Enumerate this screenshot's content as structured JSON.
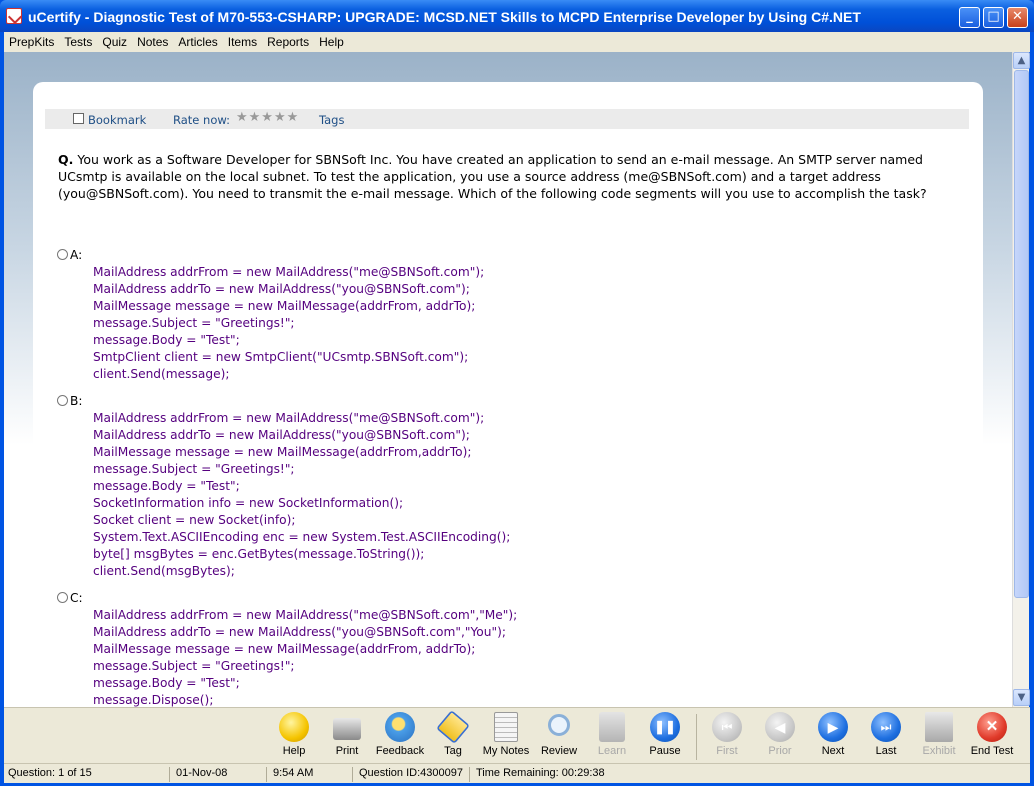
{
  "window": {
    "title": "uCertify - Diagnostic Test of  M70-553-CSHARP: UPGRADE: MCSD.NET Skills to MCPD Enterprise Developer by Using C#.NET",
    "minimize": "_",
    "maximize": "□",
    "close": "✕"
  },
  "menu": [
    "PrepKits",
    "Tests",
    "Quiz",
    "Notes",
    "Articles",
    "Items",
    "Reports",
    "Help"
  ],
  "question_toolbar": {
    "bookmark": "Bookmark",
    "rate_now": "Rate now:",
    "stars": "★★★★★",
    "tags": "Tags"
  },
  "question": {
    "prefix": "Q.",
    "text": "You work as a Software Developer for SBNSoft Inc. You have created an application to send an e-mail message. An SMTP server named UCsmtp is available on the local subnet. To test the application, you use a source address (me@SBNSoft.com) and a target address (you@SBNSoft.com). You need to transmit the e-mail message. Which of the following code segments will you use to accomplish the task?"
  },
  "options": [
    {
      "label": "A:",
      "lines": [
        "MailAddress addrFrom = new MailAddress(\"me@SBNSoft.com\");",
        "MailAddress addrTo = new MailAddress(\"you@SBNSoft.com\");",
        "MailMessage message = new MailMessage(addrFrom, addrTo);",
        "message.Subject = \"Greetings!\";",
        "message.Body = \"Test\";",
        "SmtpClient client = new SmtpClient(\"UCsmtp.SBNSoft.com\");",
        "client.Send(message);"
      ]
    },
    {
      "label": "B:",
      "lines": [
        "MailAddress addrFrom = new MailAddress(\"me@SBNSoft.com\");",
        "MailAddress addrTo = new MailAddress(\"you@SBNSoft.com\");",
        "MailMessage message = new MailMessage(addrFrom,addrTo);",
        "message.Subject = \"Greetings!\";",
        "message.Body = \"Test\";",
        "SocketInformation info = new SocketInformation();",
        "Socket client = new Socket(info);",
        "System.Text.ASCIIEncoding enc = new System.Test.ASCIIEncoding();",
        "byte[] msgBytes = enc.GetBytes(message.ToString());",
        "client.Send(msgBytes);"
      ]
    },
    {
      "label": "C:",
      "lines": [
        "MailAddress addrFrom = new MailAddress(\"me@SBNSoft.com\",\"Me\");",
        "MailAddress addrTo = new MailAddress(\"you@SBNSoft.com\",\"You\");",
        "MailMessage message = new MailMessage(addrFrom, addrTo);",
        "message.Subject = \"Greetings!\";",
        "message.Body = \"Test\";",
        "message.Dispose();"
      ]
    }
  ],
  "toolbar": [
    {
      "label": "Help",
      "icon": "help-icon",
      "color": "#f5c400",
      "enabled": true
    },
    {
      "label": "Print",
      "icon": "print-icon",
      "color": "#8a8a8a",
      "enabled": true
    },
    {
      "label": "Feedback",
      "icon": "feedback-icon",
      "color": "#4a9ee8",
      "enabled": true
    },
    {
      "label": "Tag",
      "icon": "tag-icon",
      "color": "#3a6fd0",
      "enabled": true
    },
    {
      "label": "My Notes",
      "icon": "notes-icon",
      "color": "#9a9a9a",
      "enabled": true
    },
    {
      "label": "Review",
      "icon": "review-icon",
      "color": "#8ab0d8",
      "enabled": true
    },
    {
      "label": "Learn",
      "icon": "learn-icon",
      "color": "#c0c0c0",
      "enabled": false
    },
    {
      "label": "Pause",
      "icon": "pause-icon",
      "color": "#1e6fe0",
      "enabled": true
    },
    {
      "label": "First",
      "icon": "first-icon",
      "color": "#c8c8c8",
      "enabled": false
    },
    {
      "label": "Prior",
      "icon": "prior-icon",
      "color": "#c8c8c8",
      "enabled": false
    },
    {
      "label": "Next",
      "icon": "next-icon",
      "color": "#1e6fe0",
      "enabled": true
    },
    {
      "label": "Last",
      "icon": "last-icon",
      "color": "#1e6fe0",
      "enabled": true
    },
    {
      "label": "Exhibit",
      "icon": "exhibit-icon",
      "color": "#c0c0c0",
      "enabled": false
    },
    {
      "label": "End Test",
      "icon": "end-test-icon",
      "color": "#e03a2a",
      "enabled": true
    }
  ],
  "status": {
    "question": "Question: 1 of 15",
    "date": "01-Nov-08",
    "time": "9:54 AM",
    "question_id": "Question ID:4300097",
    "time_remaining": "Time Remaining: 00:29:38"
  }
}
